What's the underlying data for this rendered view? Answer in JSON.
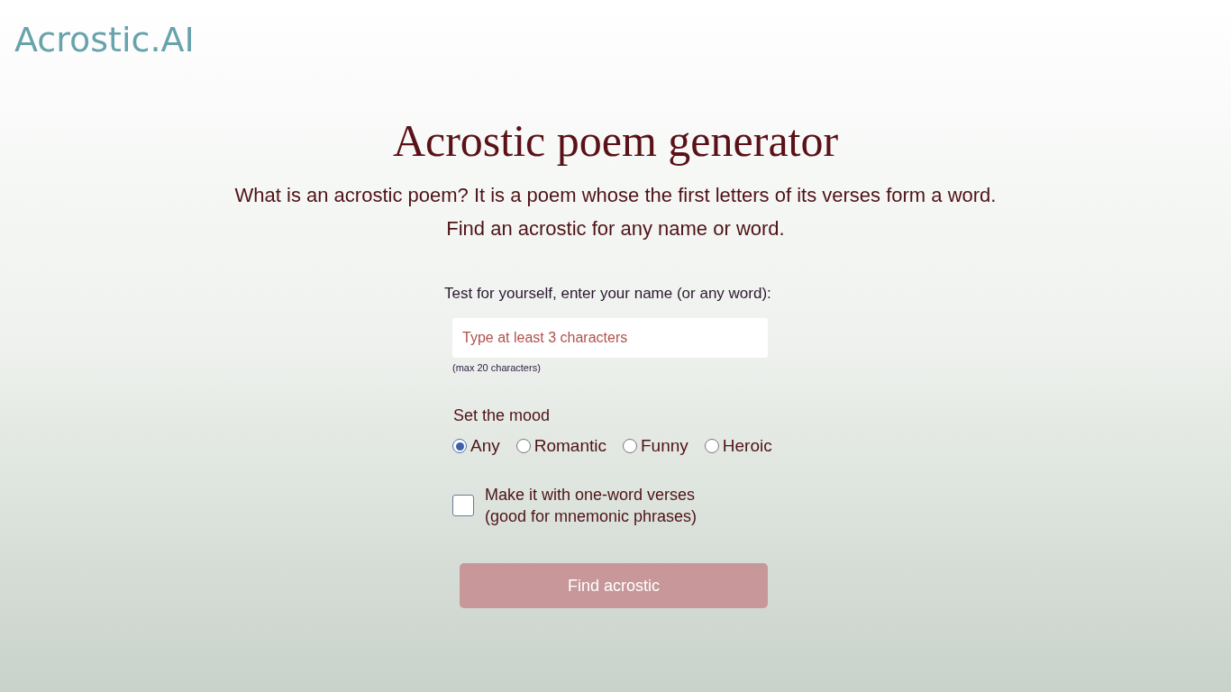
{
  "logo": {
    "text": "Acrostic.AI"
  },
  "hero": {
    "title": "Acrostic poem generator",
    "lines": [
      "What is an acrostic poem? It is a poem whose the first letters of its verses form a word.",
      "Find an acrostic for any name or word."
    ]
  },
  "form": {
    "label": "Test for yourself, enter your name (or any word):",
    "name_field": {
      "placeholder": "Type at least 3 characters"
    },
    "hint": "(max 20 characters)",
    "mood": {
      "label": "Set the mood",
      "options": [
        {
          "label": "Any",
          "selected": true
        },
        {
          "label": "Romantic",
          "selected": false
        },
        {
          "label": "Funny",
          "selected": false
        },
        {
          "label": "Heroic",
          "selected": false
        }
      ]
    },
    "one_word": {
      "lines": [
        "Make it with one-word verses",
        "(good for mnemonic phrases)"
      ],
      "checked": false
    },
    "submit": {
      "label": "Find acrostic",
      "disabled": true
    }
  }
}
